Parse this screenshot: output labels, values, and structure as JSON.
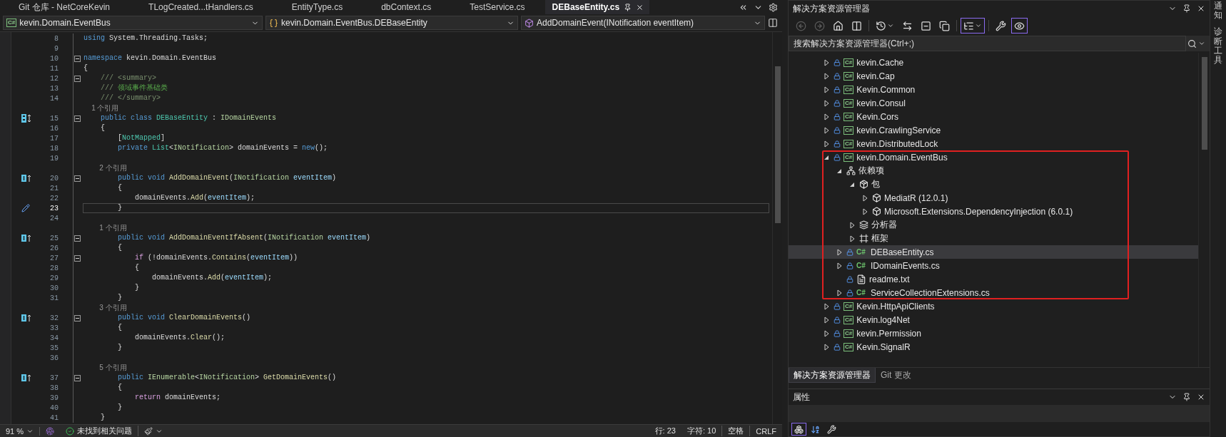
{
  "editor_tabs": [
    {
      "label": "Git 仓库 - NetCoreKevin",
      "selected": false
    },
    {
      "label": "TLogCreated...tHandlers.cs",
      "selected": false
    },
    {
      "label": "EntityType.cs",
      "selected": false
    },
    {
      "label": "dbContext.cs",
      "selected": false
    },
    {
      "label": "TestService.cs",
      "selected": false
    },
    {
      "label": "DEBaseEntity.cs",
      "selected": true
    }
  ],
  "nav_bar": [
    {
      "label": "kevin.Domain.EventBus",
      "kind": "project",
      "icon_text": "C#"
    },
    {
      "label": "kevin.Domain.EventBus.DEBaseEntity",
      "kind": "class"
    },
    {
      "label": "AddDomainEvent(INotification eventItem)",
      "kind": "method"
    }
  ],
  "code_lines": [
    {
      "kind": "code",
      "number": "8",
      "fold": false,
      "current": false,
      "tokens": [
        {
          "text": "using",
          "kind": "keyword"
        },
        {
          "text": " System.Threading.Tasks;",
          "kind": "plain"
        }
      ]
    },
    {
      "kind": "code",
      "number": "9",
      "fold": false,
      "current": false
    },
    {
      "kind": "code",
      "number": "10",
      "fold": true,
      "current": false,
      "tokens": [
        {
          "text": "namespace",
          "kind": "keyword"
        },
        {
          "text": " kevin.Domain.EventBus",
          "kind": "plain"
        }
      ]
    },
    {
      "kind": "code",
      "number": "11",
      "fold": false,
      "current": false,
      "tokens": [
        {
          "text": "{",
          "kind": "plain"
        }
      ]
    },
    {
      "kind": "code",
      "number": "12",
      "fold": true,
      "current": false,
      "tokens": [
        {
          "text": "    /// <summary>",
          "kind": "doc"
        }
      ]
    },
    {
      "kind": "code",
      "number": "13",
      "fold": false,
      "current": false,
      "tokens": [
        {
          "text": "    ///",
          "kind": "doc"
        },
        {
          "text": " 领域事件基础类",
          "kind": "comment"
        }
      ]
    },
    {
      "kind": "code",
      "number": "14",
      "fold": false,
      "current": false,
      "tokens": [
        {
          "text": "    /// </summary>",
          "kind": "doc"
        }
      ]
    },
    {
      "kind": "lens",
      "text": "1 个引用"
    },
    {
      "kind": "code",
      "number": "15",
      "marker": {
        "kind": "class"
      },
      "fold": true,
      "current": false,
      "tokens": [
        {
          "text": "    public class",
          "kind": "keyword"
        },
        {
          "text": " DEBaseEntity",
          "kind": "type"
        },
        {
          "text": " :",
          "kind": "plain"
        },
        {
          "text": " IDomainEvents",
          "kind": "interface"
        }
      ]
    },
    {
      "kind": "code",
      "number": "16",
      "fold": false,
      "current": false,
      "tokens": [
        {
          "text": "    {",
          "kind": "plain"
        }
      ]
    },
    {
      "kind": "code",
      "number": "17",
      "fold": false,
      "current": false,
      "tokens": [
        {
          "text": "        [",
          "kind": "plain"
        },
        {
          "text": "NotMapped",
          "kind": "type"
        },
        {
          "text": "]",
          "kind": "plain"
        }
      ]
    },
    {
      "kind": "code",
      "number": "18",
      "fold": false,
      "current": false,
      "tokens": [
        {
          "text": "        private",
          "kind": "keyword"
        },
        {
          "text": " List",
          "kind": "type"
        },
        {
          "text": "<",
          "kind": "plain"
        },
        {
          "text": "INotification",
          "kind": "interface"
        },
        {
          "text": "> domainEvents =",
          "kind": "plain"
        },
        {
          "text": " new",
          "kind": "keyword"
        },
        {
          "text": "();",
          "kind": "plain"
        }
      ]
    },
    {
      "kind": "code",
      "number": "19",
      "fold": false,
      "current": false
    },
    {
      "kind": "lens",
      "text": "2 个引用"
    },
    {
      "kind": "code",
      "number": "20",
      "marker": {
        "kind": "impl"
      },
      "fold": true,
      "current": false,
      "tokens": [
        {
          "text": "        public void",
          "kind": "keyword"
        },
        {
          "text": " AddDomainEvent",
          "kind": "method"
        },
        {
          "text": "(",
          "kind": "plain"
        },
        {
          "text": "INotification",
          "kind": "interface"
        },
        {
          "text": " eventItem",
          "kind": "parameter"
        },
        {
          "text": ")",
          "kind": "plain"
        }
      ]
    },
    {
      "kind": "code",
      "number": "21",
      "fold": false,
      "current": false,
      "tokens": [
        {
          "text": "        {",
          "kind": "plain"
        }
      ]
    },
    {
      "kind": "code",
      "number": "22",
      "fold": false,
      "current": false,
      "tokens": [
        {
          "text": "            domainEvents.",
          "kind": "plain"
        },
        {
          "text": "Add",
          "kind": "method"
        },
        {
          "text": "(",
          "kind": "plain"
        },
        {
          "text": "eventItem",
          "kind": "parameter"
        },
        {
          "text": ");",
          "kind": "plain"
        }
      ]
    },
    {
      "kind": "code",
      "number": "23",
      "marker": {
        "kind": "edit"
      },
      "fold": false,
      "current": true,
      "tokens": [
        {
          "text": "        }",
          "kind": "plain"
        }
      ]
    },
    {
      "kind": "code",
      "number": "24",
      "fold": false,
      "current": false
    },
    {
      "kind": "lens",
      "text": "1 个引用"
    },
    {
      "kind": "code",
      "number": "25",
      "marker": {
        "kind": "impl"
      },
      "fold": true,
      "current": false,
      "tokens": [
        {
          "text": "        public void",
          "kind": "keyword"
        },
        {
          "text": " AddDomainEventIfAbsent",
          "kind": "method"
        },
        {
          "text": "(",
          "kind": "plain"
        },
        {
          "text": "INotification",
          "kind": "interface"
        },
        {
          "text": " eventItem",
          "kind": "parameter"
        },
        {
          "text": ")",
          "kind": "plain"
        }
      ]
    },
    {
      "kind": "code",
      "number": "26",
      "fold": false,
      "current": false,
      "tokens": [
        {
          "text": "        {",
          "kind": "plain"
        }
      ]
    },
    {
      "kind": "code",
      "number": "27",
      "fold": true,
      "current": false,
      "tokens": [
        {
          "text": "            if",
          "kind": "control"
        },
        {
          "text": " (!domainEvents.",
          "kind": "plain"
        },
        {
          "text": "Contains",
          "kind": "method"
        },
        {
          "text": "(",
          "kind": "plain"
        },
        {
          "text": "eventItem",
          "kind": "parameter"
        },
        {
          "text": "))",
          "kind": "plain"
        }
      ]
    },
    {
      "kind": "code",
      "number": "28",
      "fold": false,
      "current": false,
      "tokens": [
        {
          "text": "            {",
          "kind": "plain"
        }
      ]
    },
    {
      "kind": "code",
      "number": "29",
      "fold": false,
      "current": false,
      "tokens": [
        {
          "text": "                domainEvents.",
          "kind": "plain"
        },
        {
          "text": "Add",
          "kind": "method"
        },
        {
          "text": "(",
          "kind": "plain"
        },
        {
          "text": "eventItem",
          "kind": "parameter"
        },
        {
          "text": ");",
          "kind": "plain"
        }
      ]
    },
    {
      "kind": "code",
      "number": "30",
      "fold": false,
      "current": false,
      "tokens": [
        {
          "text": "            }",
          "kind": "plain"
        }
      ]
    },
    {
      "kind": "code",
      "number": "31",
      "fold": false,
      "current": false,
      "tokens": [
        {
          "text": "        }",
          "kind": "plain"
        }
      ]
    },
    {
      "kind": "lens",
      "text": "3 个引用"
    },
    {
      "kind": "code",
      "number": "32",
      "marker": {
        "kind": "impl"
      },
      "fold": true,
      "current": false,
      "tokens": [
        {
          "text": "        public void",
          "kind": "keyword"
        },
        {
          "text": " ClearDomainEvents",
          "kind": "method"
        },
        {
          "text": "()",
          "kind": "plain"
        }
      ]
    },
    {
      "kind": "code",
      "number": "33",
      "fold": false,
      "current": false,
      "tokens": [
        {
          "text": "        {",
          "kind": "plain"
        }
      ]
    },
    {
      "kind": "code",
      "number": "34",
      "fold": false,
      "current": false,
      "tokens": [
        {
          "text": "            domainEvents.",
          "kind": "plain"
        },
        {
          "text": "Clear",
          "kind": "method"
        },
        {
          "text": "();",
          "kind": "plain"
        }
      ]
    },
    {
      "kind": "code",
      "number": "35",
      "fold": false,
      "current": false,
      "tokens": [
        {
          "text": "        }",
          "kind": "plain"
        }
      ]
    },
    {
      "kind": "code",
      "number": "36",
      "fold": false,
      "current": false
    },
    {
      "kind": "lens",
      "text": "5 个引用"
    },
    {
      "kind": "code",
      "number": "37",
      "marker": {
        "kind": "impl"
      },
      "fold": true,
      "current": false,
      "tokens": [
        {
          "text": "        public",
          "kind": "keyword"
        },
        {
          "text": " IEnumerable",
          "kind": "interface"
        },
        {
          "text": "<",
          "kind": "plain"
        },
        {
          "text": "INotification",
          "kind": "interface"
        },
        {
          "text": ">",
          "kind": "plain"
        },
        {
          "text": " GetDomainEvents",
          "kind": "method"
        },
        {
          "text": "()",
          "kind": "plain"
        }
      ]
    },
    {
      "kind": "code",
      "number": "38",
      "fold": false,
      "current": false,
      "tokens": [
        {
          "text": "        {",
          "kind": "plain"
        }
      ]
    },
    {
      "kind": "code",
      "number": "39",
      "fold": false,
      "current": false,
      "tokens": [
        {
          "text": "            return",
          "kind": "control"
        },
        {
          "text": " domainEvents;",
          "kind": "plain"
        }
      ]
    },
    {
      "kind": "code",
      "number": "40",
      "fold": false,
      "current": false,
      "tokens": [
        {
          "text": "        }",
          "kind": "plain"
        }
      ]
    },
    {
      "kind": "code",
      "number": "41",
      "fold": false,
      "current": false,
      "tokens": [
        {
          "text": "    }",
          "kind": "plain"
        }
      ]
    }
  ],
  "status_bar": {
    "zoom": "91 %",
    "issues": "未找到相关问题",
    "line": "行: 23",
    "column": "字符: 10",
    "spacing": "空格",
    "line_ending": "CRLF"
  },
  "solution_explorer": {
    "title": "解决方案资源管理器",
    "toolbar": [
      {
        "kind": "back",
        "on": false,
        "disabled": true
      },
      {
        "kind": "forward",
        "on": false,
        "disabled": true
      },
      {
        "kind": "home",
        "on": false,
        "disabled": false
      },
      {
        "kind": "switch-views",
        "on": false,
        "disabled": false
      },
      {
        "kind": "history",
        "on": false,
        "disabled": false
      },
      {
        "kind": "sync",
        "on": false,
        "disabled": false
      },
      {
        "kind": "collapse",
        "on": false,
        "disabled": false
      },
      {
        "kind": "show-all",
        "on": false,
        "disabled": false
      },
      {
        "kind": "tree-view",
        "on": true,
        "disabled": false
      },
      {
        "kind": "properties",
        "on": false,
        "disabled": false
      },
      {
        "kind": "preview",
        "on": true,
        "disabled": false
      }
    ],
    "search": {
      "placeholder": "搜索解决方案资源管理器(Ctrl+;)"
    },
    "tree": [
      {
        "label": "kevin.Cache",
        "kind": "project",
        "icon_text": "C#",
        "locked": true,
        "expanded": false,
        "selected": false,
        "annotated": false
      },
      {
        "label": "kevin.Cap",
        "kind": "project",
        "icon_text": "C#",
        "locked": true,
        "expanded": false,
        "selected": false,
        "annotated": false
      },
      {
        "label": "Kevin.Common",
        "kind": "project",
        "icon_text": "C#",
        "locked": true,
        "expanded": false,
        "selected": false,
        "annotated": false
      },
      {
        "label": "kevin.Consul",
        "kind": "project",
        "icon_text": "C#",
        "locked": true,
        "expanded": false,
        "selected": false,
        "annotated": false
      },
      {
        "label": "Kevin.Cors",
        "kind": "project",
        "icon_text": "C#",
        "locked": true,
        "expanded": false,
        "selected": false,
        "annotated": false
      },
      {
        "label": "kevin.CrawlingService",
        "kind": "project",
        "icon_text": "C#",
        "locked": true,
        "expanded": false,
        "selected": false,
        "annotated": false
      },
      {
        "label": "kevin.DistributedLock",
        "kind": "project",
        "icon_text": "C#",
        "locked": true,
        "expanded": false,
        "selected": false,
        "annotated": false
      },
      {
        "label": "kevin.Domain.EventBus",
        "kind": "project",
        "icon_text": "C#",
        "locked": true,
        "expanded": true,
        "selected": false,
        "annotated": true,
        "children": [
          {
            "label": "依赖项",
            "kind": "dependencies",
            "locked": false,
            "expanded": true,
            "selected": false,
            "children": [
              {
                "label": "包",
                "kind": "packages",
                "locked": false,
                "expanded": true,
                "selected": false,
                "children": [
                  {
                    "label": "MediatR (12.0.1)",
                    "kind": "package",
                    "locked": false,
                    "expanded": false,
                    "selected": false
                  },
                  {
                    "label": "Microsoft.Extensions.DependencyInjection (6.0.1)",
                    "kind": "package",
                    "locked": false,
                    "expanded": false,
                    "selected": false
                  }
                ]
              },
              {
                "label": "分析器",
                "kind": "analyzers",
                "locked": false,
                "expanded": false,
                "selected": false
              },
              {
                "label": "框架",
                "kind": "frameworks",
                "locked": false,
                "expanded": false,
                "selected": false
              }
            ]
          },
          {
            "label": "DEBaseEntity.cs",
            "kind": "csfile",
            "icon_text": "C#",
            "locked": true,
            "expanded": false,
            "selected": true
          },
          {
            "label": "IDomainEvents.cs",
            "kind": "csfile",
            "icon_text": "C#",
            "locked": true,
            "expanded": false,
            "selected": false
          },
          {
            "label": "readme.txt",
            "kind": "textfile",
            "locked": true,
            "selected": false
          },
          {
            "label": "ServiceCollectionExtensions.cs",
            "kind": "csfile",
            "icon_text": "C#",
            "locked": true,
            "expanded": false,
            "selected": false
          }
        ]
      },
      {
        "label": "Kevin.HttpApiClients",
        "kind": "project",
        "icon_text": "C#",
        "locked": true,
        "expanded": false,
        "selected": false,
        "annotated": false
      },
      {
        "label": "Kevin.log4Net",
        "kind": "project",
        "icon_text": "C#",
        "locked": true,
        "expanded": false,
        "selected": false,
        "annotated": false
      },
      {
        "label": "kevin.Permission",
        "kind": "project",
        "icon_text": "C#",
        "locked": true,
        "expanded": false,
        "selected": false,
        "annotated": false
      },
      {
        "label": "Kevin.SignalR",
        "kind": "project",
        "icon_text": "C#",
        "locked": true,
        "expanded": false,
        "selected": false,
        "annotated": false
      }
    ],
    "bottom_tabs": [
      {
        "label": "解决方案资源管理器",
        "selected": true
      },
      {
        "label": "Git 更改",
        "selected": false
      }
    ]
  },
  "properties": {
    "title": "属性",
    "toolbar": [
      {
        "kind": "categorized",
        "on": true
      },
      {
        "kind": "alphabetical",
        "on": false
      },
      {
        "kind": "property-pages",
        "on": false
      }
    ]
  },
  "side_tabs": [
    {
      "label": "通知"
    },
    {
      "label": "诊断工具"
    }
  ]
}
